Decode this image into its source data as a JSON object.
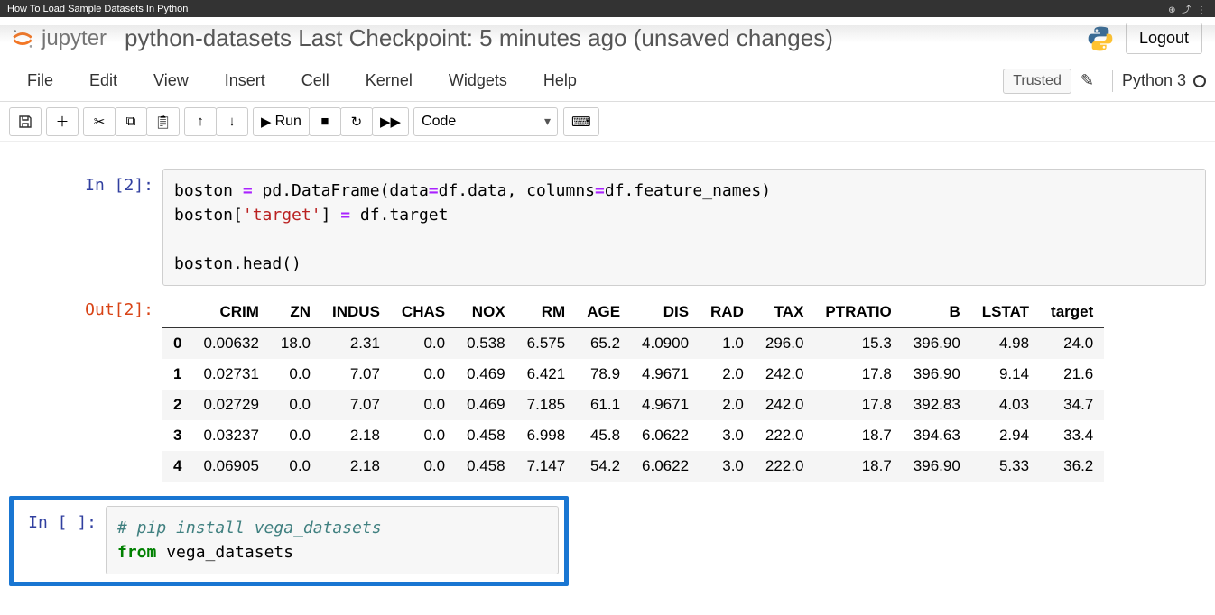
{
  "page_tab": {
    "title": "How To Load Sample Datasets In Python",
    "chrome_icons": "⊕ ⤴ ⋮"
  },
  "header": {
    "logo_text": "jupyter",
    "notebook_name": "python-datasets",
    "checkpoint": " Last Checkpoint: 5 minutes ago  (unsaved changes)",
    "logout": "Logout"
  },
  "menubar": {
    "items": [
      "File",
      "Edit",
      "View",
      "Insert",
      "Cell",
      "Kernel",
      "Widgets",
      "Help"
    ],
    "trusted": "Trusted",
    "kernel": "Python 3"
  },
  "toolbar": {
    "run_label": "Run",
    "cell_type": "Code"
  },
  "cells": {
    "in2_prompt": "In [2]:",
    "out2_prompt": "Out[2]:",
    "in_empty_prompt": "In [ ]:",
    "code2_line1a": "boston",
    "code2_line1b": " = ",
    "code2_line1c": "pd.DataFrame(data",
    "code2_line1d": "=",
    "code2_line1e": "df.data, columns",
    "code2_line1f": "=",
    "code2_line1g": "df.feature_names)",
    "code2_line2a": "boston[",
    "code2_line2b": "'target'",
    "code2_line2c": "] ",
    "code2_line2d": "=",
    "code2_line2e": " df.target",
    "code2_line4": "boston.head()",
    "code3_line1": "# pip install vega_datasets",
    "code3_line2a": "from",
    "code3_line2b": " vega_datasets"
  },
  "table": {
    "columns": [
      "",
      "CRIM",
      "ZN",
      "INDUS",
      "CHAS",
      "NOX",
      "RM",
      "AGE",
      "DIS",
      "RAD",
      "TAX",
      "PTRATIO",
      "B",
      "LSTAT",
      "target"
    ],
    "rows": [
      {
        "idx": "0",
        "vals": [
          "0.00632",
          "18.0",
          "2.31",
          "0.0",
          "0.538",
          "6.575",
          "65.2",
          "4.0900",
          "1.0",
          "296.0",
          "15.3",
          "396.90",
          "4.98",
          "24.0"
        ]
      },
      {
        "idx": "1",
        "vals": [
          "0.02731",
          "0.0",
          "7.07",
          "0.0",
          "0.469",
          "6.421",
          "78.9",
          "4.9671",
          "2.0",
          "242.0",
          "17.8",
          "396.90",
          "9.14",
          "21.6"
        ]
      },
      {
        "idx": "2",
        "vals": [
          "0.02729",
          "0.0",
          "7.07",
          "0.0",
          "0.469",
          "7.185",
          "61.1",
          "4.9671",
          "2.0",
          "242.0",
          "17.8",
          "392.83",
          "4.03",
          "34.7"
        ]
      },
      {
        "idx": "3",
        "vals": [
          "0.03237",
          "0.0",
          "2.18",
          "0.0",
          "0.458",
          "6.998",
          "45.8",
          "6.0622",
          "3.0",
          "222.0",
          "18.7",
          "394.63",
          "2.94",
          "33.4"
        ]
      },
      {
        "idx": "4",
        "vals": [
          "0.06905",
          "0.0",
          "2.18",
          "0.0",
          "0.458",
          "7.147",
          "54.2",
          "6.0622",
          "3.0",
          "222.0",
          "18.7",
          "396.90",
          "5.33",
          "36.2"
        ]
      }
    ]
  }
}
